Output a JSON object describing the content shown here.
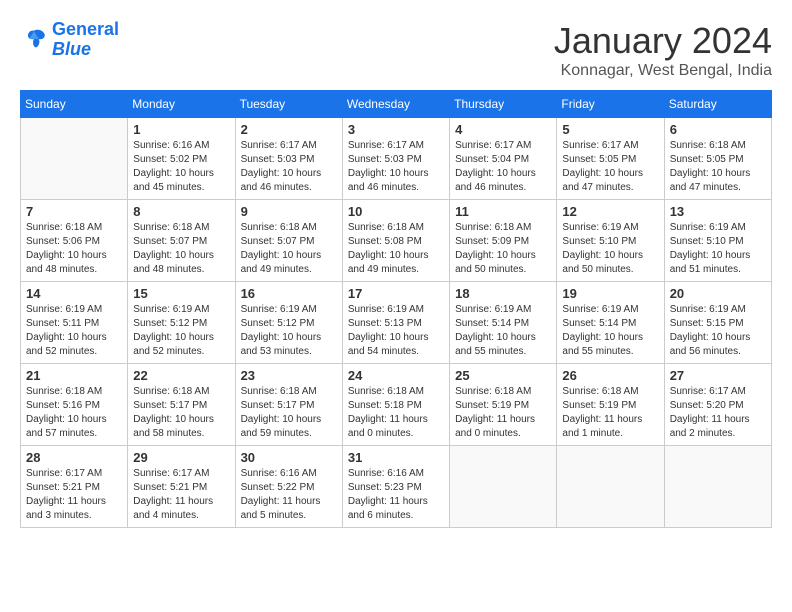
{
  "logo": {
    "line1": "General",
    "line2": "Blue"
  },
  "title": "January 2024",
  "location": "Konnagar, West Bengal, India",
  "weekdays": [
    "Sunday",
    "Monday",
    "Tuesday",
    "Wednesday",
    "Thursday",
    "Friday",
    "Saturday"
  ],
  "weeks": [
    [
      {
        "day": "",
        "info": ""
      },
      {
        "day": "1",
        "info": "Sunrise: 6:16 AM\nSunset: 5:02 PM\nDaylight: 10 hours\nand 45 minutes."
      },
      {
        "day": "2",
        "info": "Sunrise: 6:17 AM\nSunset: 5:03 PM\nDaylight: 10 hours\nand 46 minutes."
      },
      {
        "day": "3",
        "info": "Sunrise: 6:17 AM\nSunset: 5:03 PM\nDaylight: 10 hours\nand 46 minutes."
      },
      {
        "day": "4",
        "info": "Sunrise: 6:17 AM\nSunset: 5:04 PM\nDaylight: 10 hours\nand 46 minutes."
      },
      {
        "day": "5",
        "info": "Sunrise: 6:17 AM\nSunset: 5:05 PM\nDaylight: 10 hours\nand 47 minutes."
      },
      {
        "day": "6",
        "info": "Sunrise: 6:18 AM\nSunset: 5:05 PM\nDaylight: 10 hours\nand 47 minutes."
      }
    ],
    [
      {
        "day": "7",
        "info": "Sunrise: 6:18 AM\nSunset: 5:06 PM\nDaylight: 10 hours\nand 48 minutes."
      },
      {
        "day": "8",
        "info": "Sunrise: 6:18 AM\nSunset: 5:07 PM\nDaylight: 10 hours\nand 48 minutes."
      },
      {
        "day": "9",
        "info": "Sunrise: 6:18 AM\nSunset: 5:07 PM\nDaylight: 10 hours\nand 49 minutes."
      },
      {
        "day": "10",
        "info": "Sunrise: 6:18 AM\nSunset: 5:08 PM\nDaylight: 10 hours\nand 49 minutes."
      },
      {
        "day": "11",
        "info": "Sunrise: 6:18 AM\nSunset: 5:09 PM\nDaylight: 10 hours\nand 50 minutes."
      },
      {
        "day": "12",
        "info": "Sunrise: 6:19 AM\nSunset: 5:10 PM\nDaylight: 10 hours\nand 50 minutes."
      },
      {
        "day": "13",
        "info": "Sunrise: 6:19 AM\nSunset: 5:10 PM\nDaylight: 10 hours\nand 51 minutes."
      }
    ],
    [
      {
        "day": "14",
        "info": "Sunrise: 6:19 AM\nSunset: 5:11 PM\nDaylight: 10 hours\nand 52 minutes."
      },
      {
        "day": "15",
        "info": "Sunrise: 6:19 AM\nSunset: 5:12 PM\nDaylight: 10 hours\nand 52 minutes."
      },
      {
        "day": "16",
        "info": "Sunrise: 6:19 AM\nSunset: 5:12 PM\nDaylight: 10 hours\nand 53 minutes."
      },
      {
        "day": "17",
        "info": "Sunrise: 6:19 AM\nSunset: 5:13 PM\nDaylight: 10 hours\nand 54 minutes."
      },
      {
        "day": "18",
        "info": "Sunrise: 6:19 AM\nSunset: 5:14 PM\nDaylight: 10 hours\nand 55 minutes."
      },
      {
        "day": "19",
        "info": "Sunrise: 6:19 AM\nSunset: 5:14 PM\nDaylight: 10 hours\nand 55 minutes."
      },
      {
        "day": "20",
        "info": "Sunrise: 6:19 AM\nSunset: 5:15 PM\nDaylight: 10 hours\nand 56 minutes."
      }
    ],
    [
      {
        "day": "21",
        "info": "Sunrise: 6:18 AM\nSunset: 5:16 PM\nDaylight: 10 hours\nand 57 minutes."
      },
      {
        "day": "22",
        "info": "Sunrise: 6:18 AM\nSunset: 5:17 PM\nDaylight: 10 hours\nand 58 minutes."
      },
      {
        "day": "23",
        "info": "Sunrise: 6:18 AM\nSunset: 5:17 PM\nDaylight: 10 hours\nand 59 minutes."
      },
      {
        "day": "24",
        "info": "Sunrise: 6:18 AM\nSunset: 5:18 PM\nDaylight: 11 hours\nand 0 minutes."
      },
      {
        "day": "25",
        "info": "Sunrise: 6:18 AM\nSunset: 5:19 PM\nDaylight: 11 hours\nand 0 minutes."
      },
      {
        "day": "26",
        "info": "Sunrise: 6:18 AM\nSunset: 5:19 PM\nDaylight: 11 hours\nand 1 minute."
      },
      {
        "day": "27",
        "info": "Sunrise: 6:17 AM\nSunset: 5:20 PM\nDaylight: 11 hours\nand 2 minutes."
      }
    ],
    [
      {
        "day": "28",
        "info": "Sunrise: 6:17 AM\nSunset: 5:21 PM\nDaylight: 11 hours\nand 3 minutes."
      },
      {
        "day": "29",
        "info": "Sunrise: 6:17 AM\nSunset: 5:21 PM\nDaylight: 11 hours\nand 4 minutes."
      },
      {
        "day": "30",
        "info": "Sunrise: 6:16 AM\nSunset: 5:22 PM\nDaylight: 11 hours\nand 5 minutes."
      },
      {
        "day": "31",
        "info": "Sunrise: 6:16 AM\nSunset: 5:23 PM\nDaylight: 11 hours\nand 6 minutes."
      },
      {
        "day": "",
        "info": ""
      },
      {
        "day": "",
        "info": ""
      },
      {
        "day": "",
        "info": ""
      }
    ]
  ]
}
